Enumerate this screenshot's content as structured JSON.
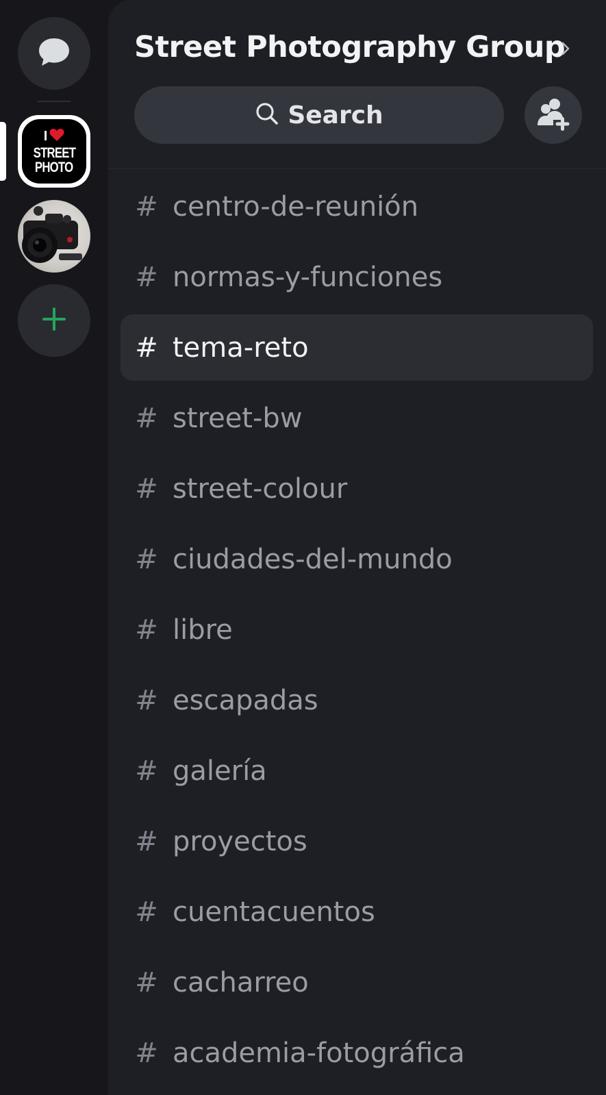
{
  "rail": {
    "direct_messages_icon": "chat-bubble-icon",
    "servers": [
      {
        "id": "street-photo",
        "logo_text_top": "I",
        "logo_text_1": "STREET",
        "logo_text_2": "PHOTO",
        "active": true
      },
      {
        "id": "camera",
        "active": false
      }
    ],
    "add_server_icon": "plus-icon",
    "add_accent": "#23a55a"
  },
  "header": {
    "guild_name": "Street Photography Group",
    "chevron_icon": "chevron-right-icon"
  },
  "search": {
    "label": "Search",
    "icon": "search-icon"
  },
  "invite": {
    "icon": "add-user-icon"
  },
  "channels": [
    {
      "name": "centro-de-reunión",
      "selected": false
    },
    {
      "name": "normas-y-funciones",
      "selected": false
    },
    {
      "name": "tema-reto",
      "selected": true
    },
    {
      "name": "street-bw",
      "selected": false
    },
    {
      "name": "street-colour",
      "selected": false
    },
    {
      "name": "ciudades-del-mundo",
      "selected": false
    },
    {
      "name": "libre",
      "selected": false
    },
    {
      "name": "escapadas",
      "selected": false
    },
    {
      "name": "galería",
      "selected": false
    },
    {
      "name": "proyectos",
      "selected": false
    },
    {
      "name": "cuentacuentos",
      "selected": false
    },
    {
      "name": "cacharreo",
      "selected": false
    },
    {
      "name": "academia-fotográfica",
      "selected": false
    }
  ],
  "channel_prefix": "#",
  "colors": {
    "background": "#17171b",
    "panel": "#1e1f24",
    "selected_row": "#2b2d33",
    "muted_text": "#9a9ca6",
    "active_text": "#f2f3f5"
  }
}
